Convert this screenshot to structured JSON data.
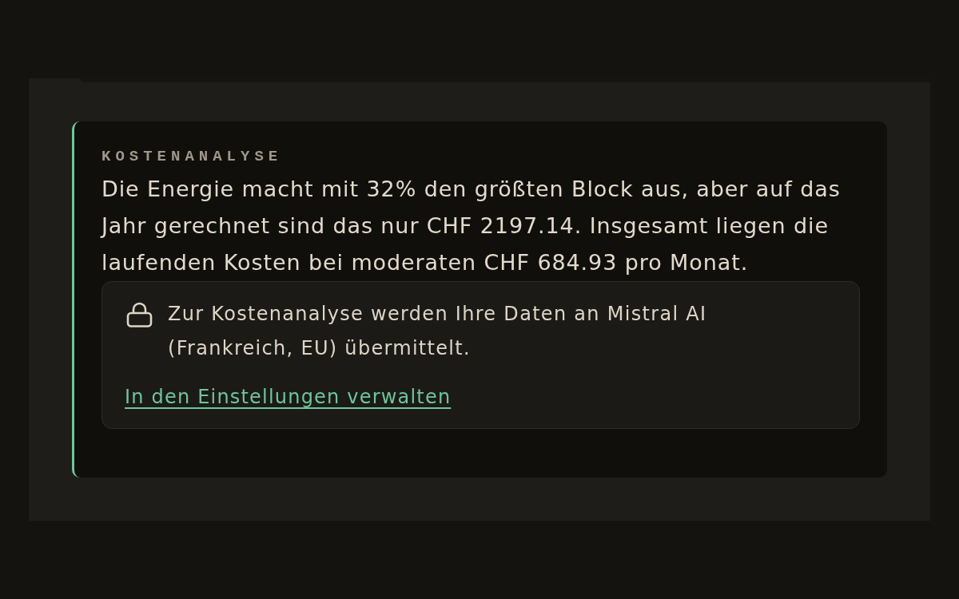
{
  "card": {
    "label": "KOSTENANALYSE",
    "text": "Die Energie macht mit 32% den größten Block aus, aber auf das Jahr gerechnet sind das nur CHF 2197.14. Insgesamt liegen die laufenden Kosten bei moderaten CHF 684.93 pro Monat.",
    "notice": {
      "text": "Zur Kostenanalyse werden Ihre Daten an Mistral AI (Frankreich, EU) übermittelt.",
      "link": "In den Einstellungen verwalten"
    }
  }
}
